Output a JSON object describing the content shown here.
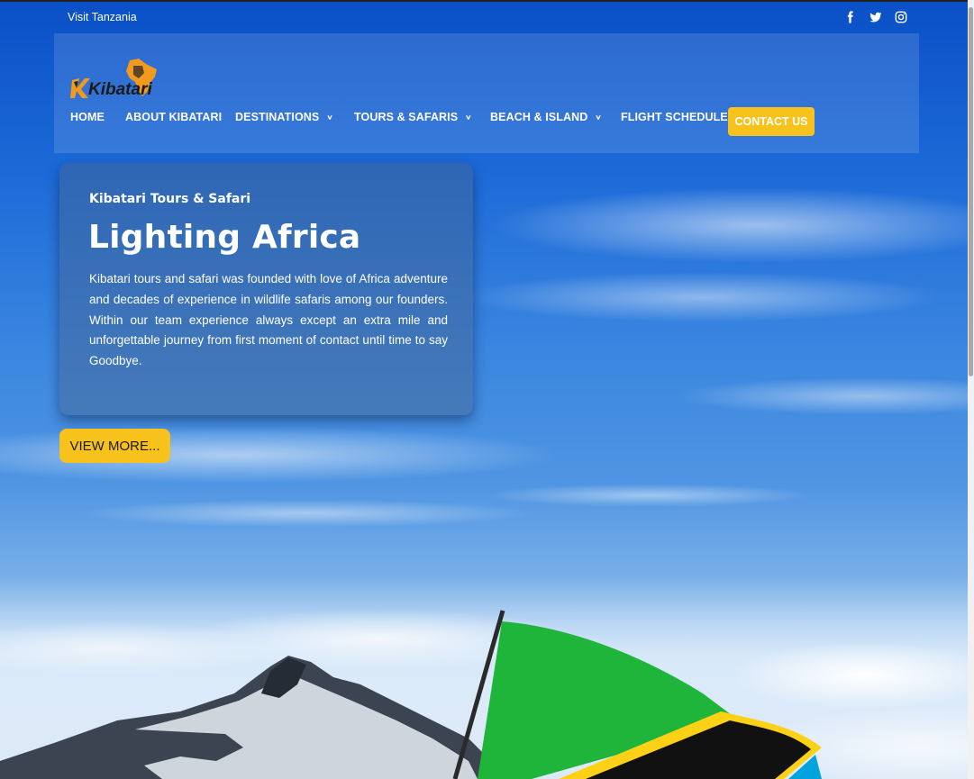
{
  "topbar": {
    "visit_label": "Visit Tanzania",
    "social_icons": [
      "facebook-icon",
      "twitter-icon",
      "instagram-icon"
    ]
  },
  "brand": {
    "logo_text": "Kibatari",
    "accent_color": "#f7c21c"
  },
  "nav": {
    "items": [
      {
        "label": "HOME",
        "has_dropdown": false
      },
      {
        "label": "ABOUT KIBATARI",
        "has_dropdown": false
      },
      {
        "label": "DESTINATIONS",
        "has_dropdown": true
      },
      {
        "label": "TOURS & SAFARIS",
        "has_dropdown": true
      },
      {
        "label": "BEACH & ISLAND",
        "has_dropdown": true
      },
      {
        "label": "FLIGHT SCHEDULE",
        "has_dropdown": false
      }
    ],
    "contact_label": "CONTACT US"
  },
  "hero": {
    "kicker": "Kibatari Tours & Safari",
    "title": "Lighting Africa",
    "text": "Kibatari tours and safari was founded with love of Africa adventure and decades of experience in wildlife safaris among our founders. Within our team experience always except an extra mile and unforgettable journey from first moment of contact until time to say Goodbye.",
    "cta_label": "VIEW MORE..."
  }
}
